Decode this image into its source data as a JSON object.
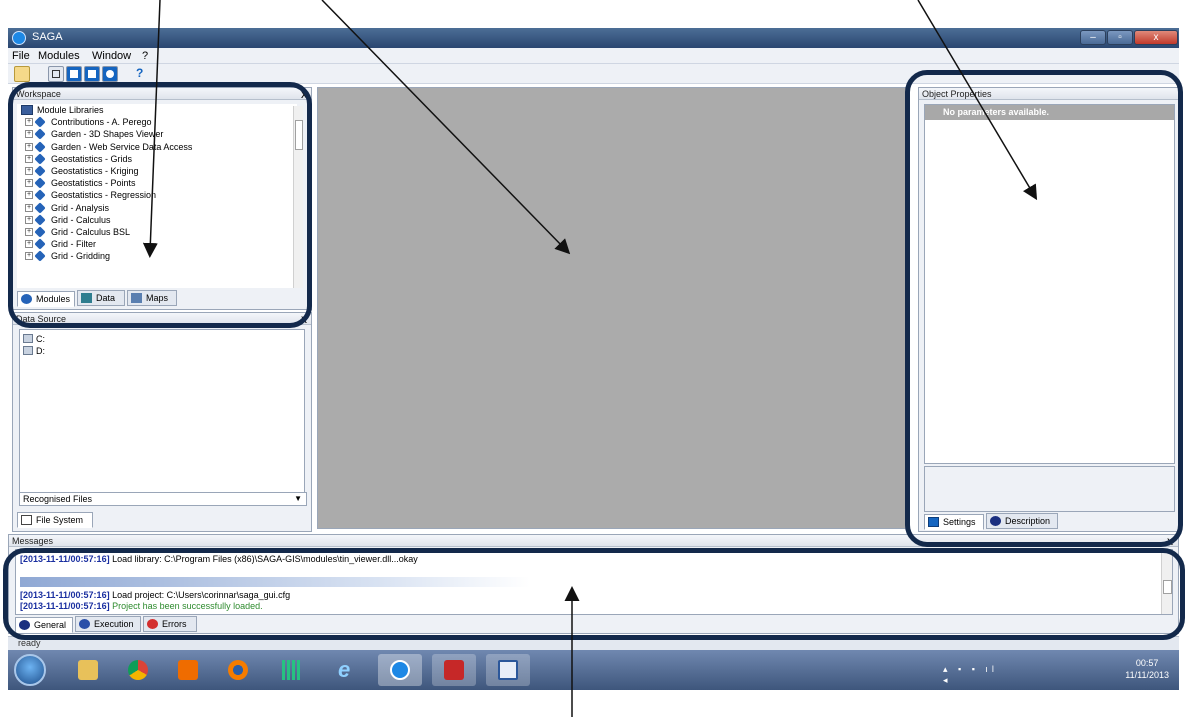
{
  "window": {
    "title": "SAGA",
    "controls": {
      "minimize": "–",
      "maximize": "▫",
      "close": "x"
    }
  },
  "menu": [
    "File",
    "Modules",
    "Window",
    "?"
  ],
  "toolbar": {
    "icons": [
      "open-icon",
      "workspace-toggle-icon",
      "settings-toggle-icon",
      "messages-toggle-icon",
      "description-toggle-icon",
      "help-icon"
    ],
    "help_label": "?"
  },
  "workspace": {
    "title": "Workspace",
    "close_label": "x",
    "root_label": "Module Libraries",
    "items": [
      "Contributions - A. Perego",
      "Garden - 3D Shapes Viewer",
      "Garden - Web Service Data Access",
      "Geostatistics - Grids",
      "Geostatistics - Kriging",
      "Geostatistics - Points",
      "Geostatistics - Regression",
      "Grid - Analysis",
      "Grid - Calculus",
      "Grid - Calculus BSL",
      "Grid - Filter",
      "Grid - Gridding"
    ],
    "tabs": [
      "Modules",
      "Data",
      "Maps"
    ]
  },
  "data_source": {
    "title": "Data Source",
    "close_label": "x",
    "drives": [
      "C:",
      "D:"
    ],
    "filter_value": "Recognised Files",
    "tab": "File System"
  },
  "object_properties": {
    "title": "Object Properties",
    "empty_message": "No parameters available.",
    "tabs": [
      "Settings",
      "Description"
    ]
  },
  "messages": {
    "title": "Messages",
    "close_label": "x",
    "lines": [
      {
        "timestamp": "[2013-11-11/00:57:16]",
        "text": "Load library: C:\\Program Files (x86)\\SAGA-GIS\\modules\\tin_viewer.dll...okay"
      },
      {
        "timestamp": "[2013-11-11/00:57:16]",
        "text": "Load project: C:\\Users\\corinnar\\saga_gui.cfg"
      },
      {
        "timestamp": "[2013-11-11/00:57:16]",
        "text": "Project has been successfully loaded."
      }
    ],
    "tabs": [
      "General",
      "Execution",
      "Errors"
    ]
  },
  "status_bar": {
    "text": "ready"
  },
  "taskbar": {
    "apps": [
      "explorer-icon",
      "chrome-icon",
      "media-icon",
      "firefox-icon",
      "grid-app-icon",
      "ie-icon",
      "saga-icon",
      "acrobat-icon",
      "word-icon"
    ],
    "clock_time": "00:57",
    "clock_date": "11/11/2013"
  },
  "colors": {
    "annotation_ring": "#13294b",
    "center_area": "#ababab",
    "timestamp": "#1a2fa0",
    "success_text": "#2e8b2e"
  }
}
